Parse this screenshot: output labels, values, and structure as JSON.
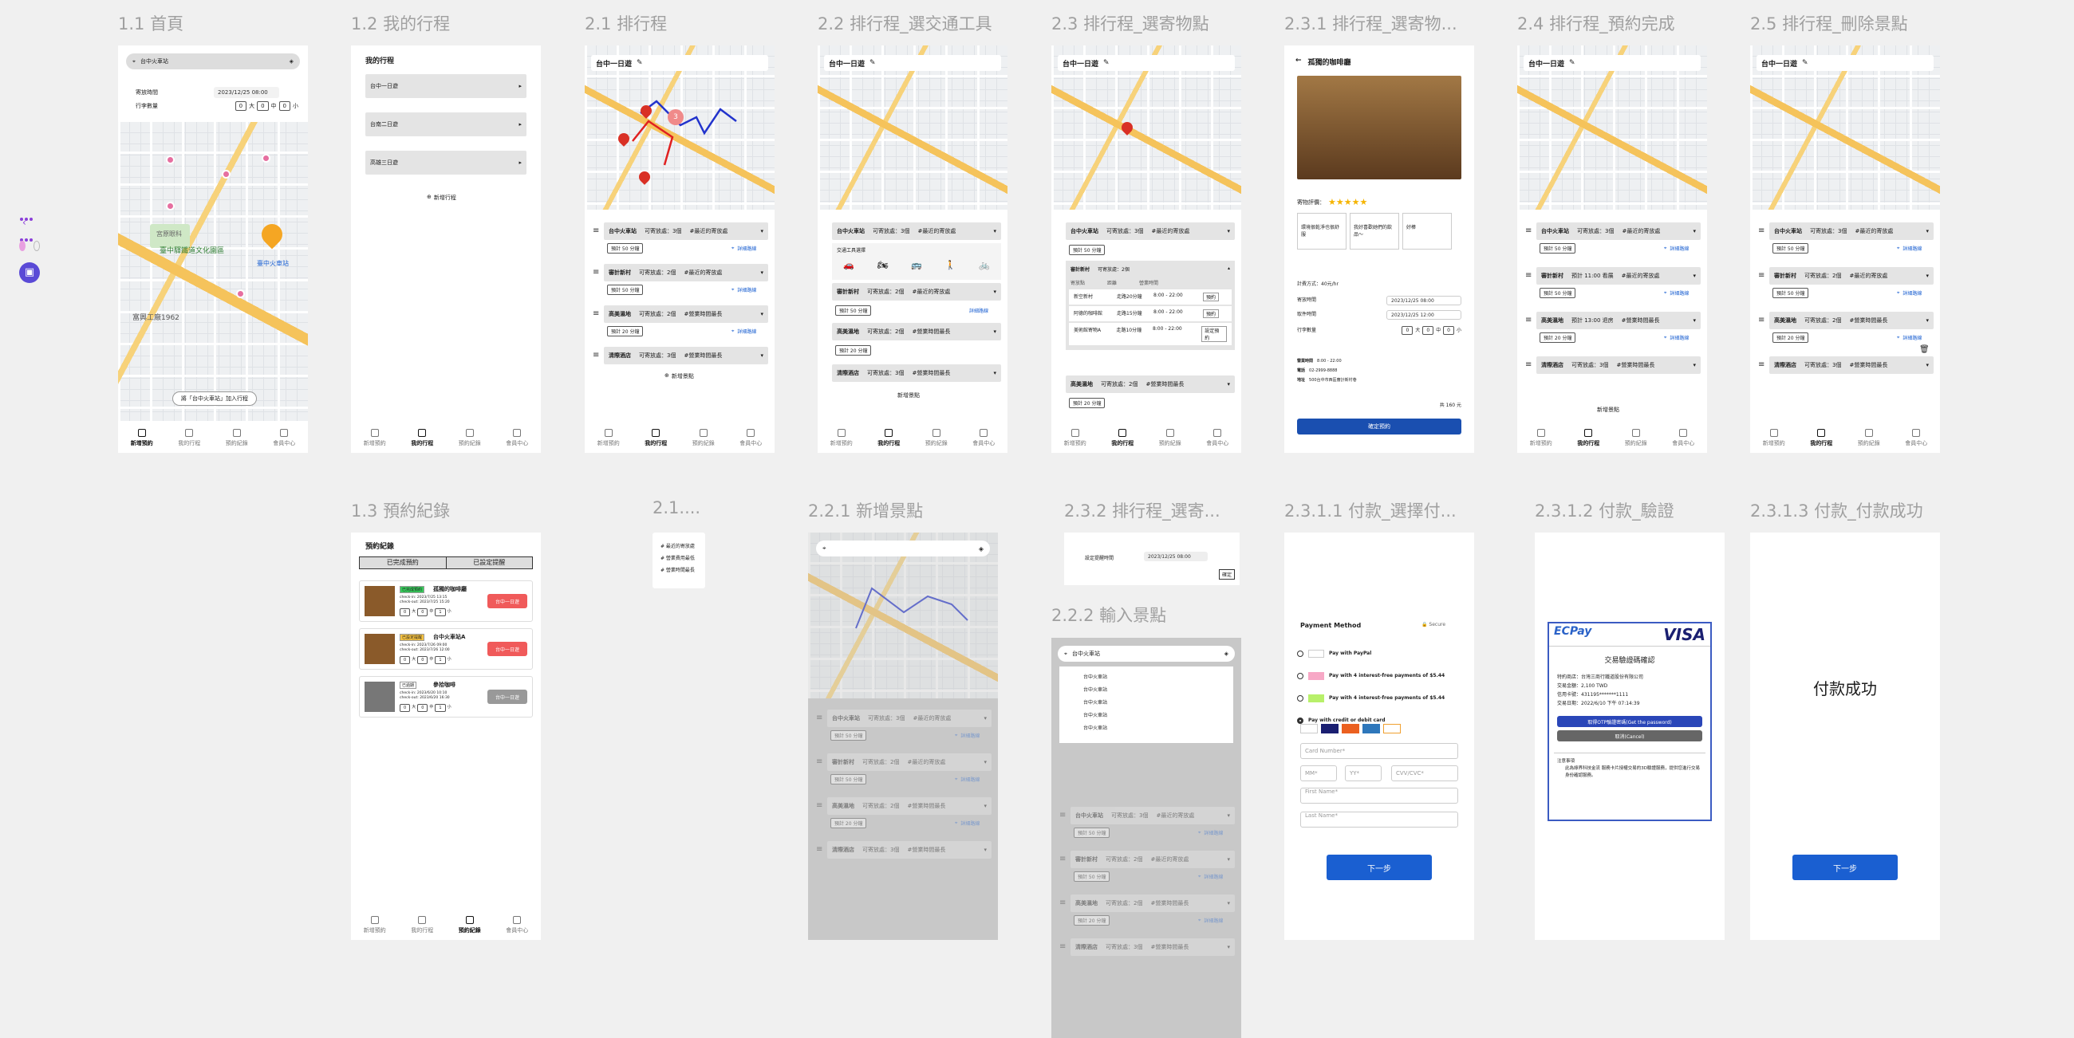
{
  "colors": {
    "primary": "#1a5fd1",
    "danger": "#f05a5a",
    "accent": "#8b3fd9"
  },
  "frames": [
    {
      "id": "f11",
      "title": "1.1 首頁"
    },
    {
      "id": "f12",
      "title": "1.2 我的行程"
    },
    {
      "id": "f21",
      "title": "2.1 排行程"
    },
    {
      "id": "f22",
      "title": "2.2 排行程_選交通工具"
    },
    {
      "id": "f23",
      "title": "2.3 排行程_選寄物點"
    },
    {
      "id": "f231",
      "title": "2.3.1 排行程_選寄物..."
    },
    {
      "id": "f24",
      "title": "2.4 排行程_預約完成"
    },
    {
      "id": "f25",
      "title": "2.5 排行程_刪除景點"
    },
    {
      "id": "f13",
      "title": "1.3 預約紀錄"
    },
    {
      "id": "f21x",
      "title": "2.1...."
    },
    {
      "id": "f221",
      "title": "2.2.1 新增景點"
    },
    {
      "id": "f232",
      "title": "2.3.2 排行程_選寄..."
    },
    {
      "id": "f222",
      "title": "2.2.2 輸入景點"
    },
    {
      "id": "f2311",
      "title": "2.3.1.1 付款_選擇付..."
    },
    {
      "id": "f2312",
      "title": "2.3.1.2 付款_驗證"
    },
    {
      "id": "f2313",
      "title": "2.3.1.3 付款_付款成功"
    }
  ],
  "tabs": [
    "新增預約",
    "我的行程",
    "預約紀錄",
    "會員中心"
  ],
  "home": {
    "search": "台中火車站",
    "checkin_label": "寄放時間",
    "checkin_value": "2023/12/25 08:00",
    "luggage_label": "行李數量",
    "sizes": [
      "大",
      "中",
      "小"
    ],
    "counts": [
      "0",
      "0",
      "0"
    ],
    "station_label": "臺中火車站",
    "map_labels": [
      "臺中驛鐵道文化園區",
      "富興工廠1962",
      "宮原眼科"
    ],
    "add_btn": "將「台中火車站」加入行程"
  },
  "mytrips": {
    "title": "我的行程",
    "items": [
      "台中一日遊",
      "台南二日遊",
      "高雄三日遊"
    ],
    "add": "新增行程"
  },
  "plan": {
    "title": "台中一日遊",
    "stops": [
      {
        "name": "台中火車站",
        "storage": "可寄放處：3個",
        "tag": "#最近的寄放處",
        "dur": "預計 50 分鐘",
        "nav": "詳細路線"
      },
      {
        "name": "審計新村",
        "storage": "可寄放處：2個",
        "tag": "#最近的寄放處",
        "dur": "預計 50 分鐘",
        "nav": "詳細路線"
      },
      {
        "name": "高美濕地",
        "storage": "可寄放處：2個",
        "tag": "#營業時間最長",
        "dur": "預計 20 分鐘",
        "nav": "詳細路線"
      },
      {
        "name": "清際酒店",
        "storage": "可寄放處：3個",
        "tag": "#營業時間最長",
        "dur": "",
        "nav": ""
      }
    ],
    "add": "新增景點"
  },
  "transport": {
    "label": "交通工具選擇"
  },
  "storage": {
    "title": "審計新村",
    "count": "可寄放處：2個",
    "cols": [
      "寄放點",
      "距離",
      "營業時間"
    ],
    "rows": [
      {
        "name": "新空新村",
        "dist": "走路20分鐘",
        "hours": "8:00 - 22:00",
        "act": "預約"
      },
      {
        "name": "阿德的咖啡館",
        "dist": "走路15分鐘",
        "hours": "8:00 - 22:00",
        "act": "預約"
      },
      {
        "name": "美術館寄物A",
        "dist": "走路10分鐘",
        "hours": "8:00 - 22:00",
        "act": "設定預約"
      }
    ]
  },
  "cafe": {
    "title": "孤獨的咖啡廳",
    "rating_label": "寄物評價：",
    "stars": "★★★★★",
    "reviews": [
      "環境很乾淨也很舒服",
      "我好喜歡她們的飲品～",
      "好棒"
    ],
    "price_label": "計費方式：",
    "price": "40元/hr",
    "in_label": "寄放時間",
    "in": "2023/12/25 08:00",
    "out_label": "取件時間",
    "out": "2023/12/25 12:00",
    "bags_label": "行李數量",
    "hours_label": "營業時間",
    "hours": "8:00 - 22:00",
    "phone_label": "電話",
    "phone": "02-2999-8888",
    "addr_label": "地址",
    "addr": "500台中市西區審計新村巷",
    "total": "共 160 元",
    "confirm": "確定預約"
  },
  "booked": {
    "dur1": "預計 11:00 看展",
    "dur2": "預計 13:00 退房"
  },
  "records": {
    "title": "預約紀錄",
    "tabs": [
      "已完成預約",
      "已設定提醒"
    ],
    "items": [
      {
        "badge": "已完成預約",
        "name": "孤獨的咖啡廳",
        "info": "check-in: 2023/7/25 13:15",
        "info2": "check-out: 2023/7/25 15:20",
        "btn": "台中一日遊",
        "counts": [
          "0",
          "0",
          "1"
        ]
      },
      {
        "badge": "已設定提醒",
        "name": "台中火車站A",
        "info": "check-in: 2023/7/26 09:00",
        "info2": "check-out: 2023/7/26 12:00",
        "btn": "台中一日遊",
        "counts": [
          "0",
          "0",
          "1"
        ]
      },
      {
        "badge": "已過期",
        "name": "參拾咖啡",
        "info": "check-in: 2023/6/20 10:10",
        "info2": "check-out: 2023/6/20 16:30",
        "btn": "台中一日遊",
        "counts": [
          "0",
          "0",
          "1"
        ]
      }
    ]
  },
  "sort": {
    "items": [
      "# 最近的寄放處",
      "# 營業費用最低",
      "# 營業時間最長"
    ]
  },
  "reminder": {
    "label": "設定提醒時間",
    "value": "2023/12/25 08:00",
    "ok": "確定"
  },
  "suggest": {
    "input": "台中火車站",
    "list": [
      "台中火車站",
      "台中火車站",
      "台中火車站",
      "台中火車站",
      "台中火車站"
    ]
  },
  "payment": {
    "title": "Payment Method",
    "secure": "Secure",
    "options": [
      "Pay with PayPal",
      "Pay with 4 interest-free payments of $5.44",
      "Pay with 4 interest-free payments of $5.44",
      "Pay with credit or debit card"
    ],
    "card": "Card Number*",
    "mm": "MM*",
    "yy": "YY*",
    "cvc": "CVV/CVC*",
    "first": "First Name*",
    "last": "Last Name*",
    "next": "下一步"
  },
  "verify": {
    "brand": "ECPay",
    "visa": "VISA",
    "title": "交易驗證碼確認",
    "lines": [
      "特約商店：台灣三商行鐵道股份有限公司",
      "交易金額：2,100 TWD",
      "信用卡號：431195*******1111",
      "交易日期：2022/6/10 下午 07:14:39"
    ],
    "btn1": "取得OTP驗證密碼(Get the password)",
    "btn2": "取消(Cancel)",
    "note": "注意事項",
    "note_body": "此為綠界科技金流 服務卡片授權交易的3D驗證服務，提供您進行交易身份確認服務。"
  },
  "success": {
    "text": "付款成功",
    "next": "下一步"
  }
}
